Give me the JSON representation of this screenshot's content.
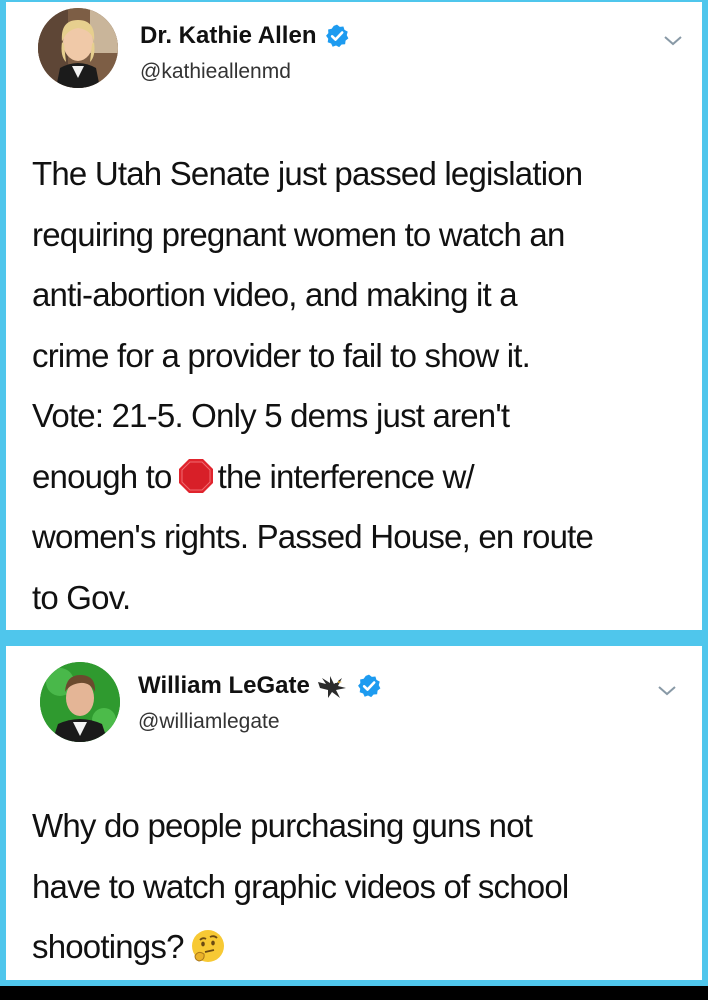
{
  "tweets": [
    {
      "author": "Dr. Kathie Allen",
      "handle": "@kathieallenmd",
      "verified": true,
      "text_lines": [
        "The Utah Senate just passed legislation",
        "requiring pregnant women to watch an",
        "anti-abortion video, and making it a",
        "crime for a provider to fail to show it.",
        "Vote: 21-5. Only 5 dems just aren't"
      ],
      "line6_before": "enough to",
      "line6_emoji": "stop-sign-icon",
      "line6_after": "the interference w/",
      "text_lines_end": [
        "women's rights. Passed House, en route",
        "to Gov."
      ]
    },
    {
      "author": "William LeGate",
      "author_emoji": "eagle-icon",
      "handle": "@williamlegate",
      "verified": true,
      "text_lines": [
        "Why do people purchasing guns not",
        "have to watch graphic videos of school"
      ],
      "last_line": "shootings?",
      "last_emoji": "thinking-face-icon"
    }
  ],
  "colors": {
    "frame": "#4fc6ec",
    "verified": "#1d9bf0",
    "stop": "#e0242d"
  }
}
